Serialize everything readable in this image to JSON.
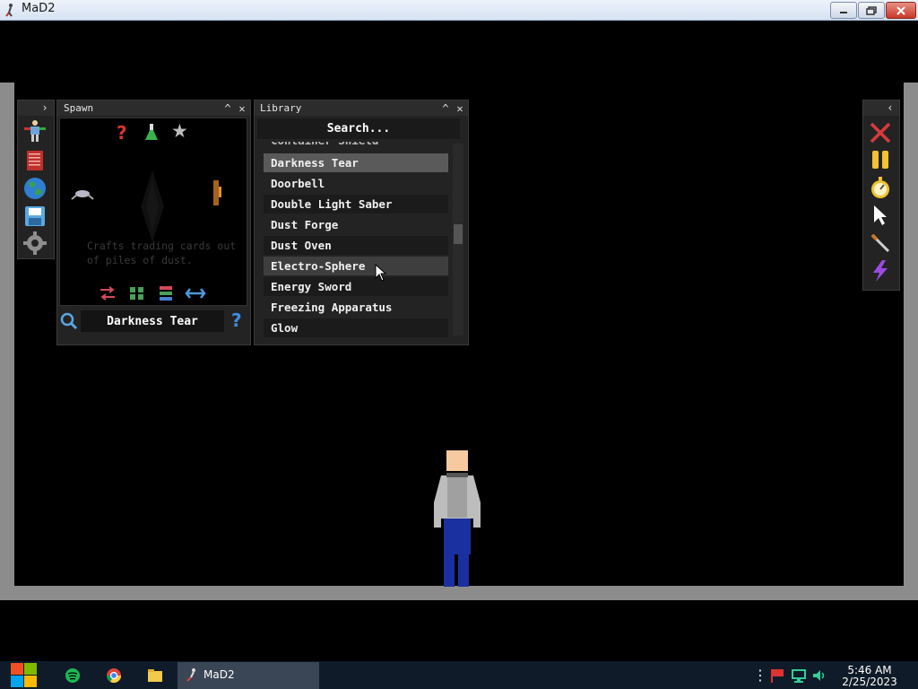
{
  "window": {
    "title": "MaD2"
  },
  "spawn": {
    "title": "Spawn",
    "description": "Crafts trading cards out\nof piles of dust.",
    "selected_name": "Darkness Tear"
  },
  "library": {
    "title": "Library",
    "search_label": "Search...",
    "items": [
      {
        "label": "Container Shield",
        "state": "partial"
      },
      {
        "label": "Darkness Tear",
        "state": "selected"
      },
      {
        "label": "Doorbell",
        "state": "normal"
      },
      {
        "label": "Double Light Saber",
        "state": "alt"
      },
      {
        "label": "Dust Forge",
        "state": "normal"
      },
      {
        "label": "Dust Oven",
        "state": "alt"
      },
      {
        "label": "Electro-Sphere",
        "state": "hover"
      },
      {
        "label": "Energy Sword",
        "state": "alt"
      },
      {
        "label": "Freezing Apparatus",
        "state": "normal"
      },
      {
        "label": "Glow",
        "state": "alt"
      }
    ]
  },
  "left_toolbar": {
    "icons": [
      "ragdoll-icon",
      "book-icon",
      "globe-icon",
      "save-icon",
      "gear-icon"
    ]
  },
  "right_toolbar": {
    "icons": [
      "delete-x-icon",
      "pause-icon",
      "stopwatch-icon",
      "cursor-icon",
      "sword-tool-icon",
      "lightning-icon"
    ]
  },
  "taskbar": {
    "task_label": "MaD2",
    "time": "5:46 AM",
    "date": "2/25/2023"
  },
  "colors": {
    "panel_bg": "#232323",
    "selected_row": "#5a5a5a",
    "hover_row": "#3e3e3e",
    "alt_row": "#1b1b1b",
    "scene_wall": "#8c8c8c"
  }
}
